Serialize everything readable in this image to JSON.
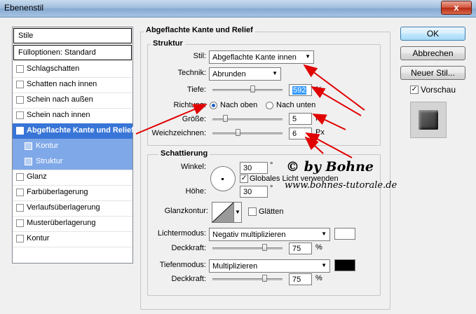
{
  "window": {
    "title": "Ebenenstil",
    "close_label": "x"
  },
  "left_panel": {
    "items": [
      {
        "label": "Stile"
      },
      {
        "label": "Fülloptionen: Standard"
      },
      {
        "label": "Schlagschatten"
      },
      {
        "label": "Schatten nach innen"
      },
      {
        "label": "Schein nach außen"
      },
      {
        "label": "Schein nach innen"
      },
      {
        "label": "Abgeflachte Kante und Relief",
        "checked_mark": "✓"
      },
      {
        "label": "Kontur"
      },
      {
        "label": "Struktur"
      },
      {
        "label": "Glanz"
      },
      {
        "label": "Farbüberlagerung"
      },
      {
        "label": "Verlaufsüberlagerung"
      },
      {
        "label": "Musterüberlagerung"
      },
      {
        "label": "Kontur"
      }
    ]
  },
  "main": {
    "section_title": "Abgeflachte Kante und Relief",
    "structure": {
      "title": "Struktur",
      "style_label": "Stil:",
      "style_value": "Abgeflachte Kante innen",
      "technique_label": "Technik:",
      "technique_value": "Abrunden",
      "depth_label": "Tiefe:",
      "depth_value": "592",
      "depth_unit": "%",
      "direction_label": "Richtung:",
      "direction_up": "Nach oben",
      "direction_down": "Nach unten",
      "size_label": "Größe:",
      "size_value": "5",
      "size_unit": "Px",
      "soften_label": "Weichzeichnen:",
      "soften_value": "6",
      "soften_unit": "Px"
    },
    "shading": {
      "title": "Schattierung",
      "angle_label": "Winkel:",
      "angle_value": "30",
      "angle_unit": "°",
      "global_light_label": "Globales Licht verwenden",
      "global_light_mark": "✓",
      "altitude_label": "Höhe:",
      "altitude_value": "30",
      "altitude_unit": "°",
      "gloss_label": "Glanzkontur:",
      "antialias_label": "Glätten",
      "highlight_mode_label": "Lichtermodus:",
      "highlight_mode_value": "Negativ multiplizieren",
      "highlight_opacity_label": "Deckkraft:",
      "highlight_opacity_value": "75",
      "highlight_opacity_unit": "%",
      "shadow_mode_label": "Tiefenmodus:",
      "shadow_mode_value": "Multiplizieren",
      "shadow_opacity_label": "Deckkraft:",
      "shadow_opacity_value": "75",
      "shadow_opacity_unit": "%"
    }
  },
  "buttons": {
    "ok": "OK",
    "cancel": "Abbrechen",
    "new_style": "Neuer Stil...",
    "preview_label": "Vorschau",
    "preview_mark": "✓"
  },
  "overlay": {
    "credit": "© by Bohne",
    "url": "www.bohnes-tutorale.de"
  },
  "colors": {
    "highlight_color": "#ffffff",
    "shadow_color": "#000000",
    "selection": "#3875d7",
    "annotation_arrow": "#e00000"
  }
}
